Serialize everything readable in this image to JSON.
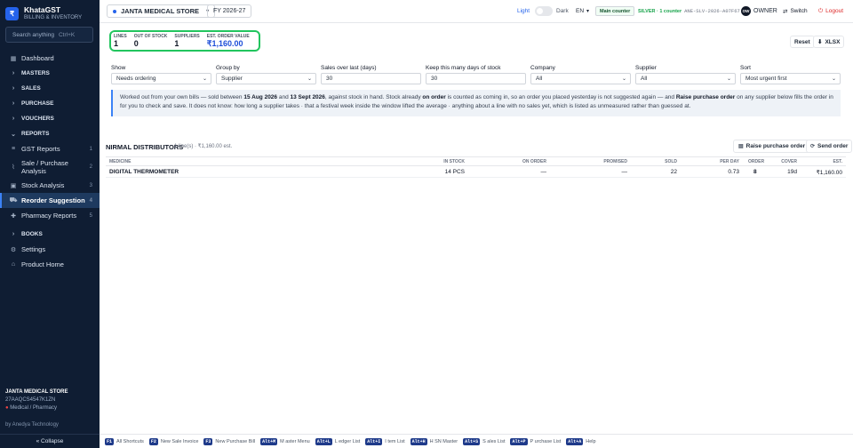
{
  "app": {
    "name": "KhataGST",
    "subtitle": "BILLING & INVENTORY",
    "logo_glyph": "₹"
  },
  "search": {
    "placeholder": "Search anything",
    "shortcut": "Ctrl+K"
  },
  "sidebar": {
    "items": [
      {
        "label": "Dashboard",
        "icon": "grid-icon"
      },
      {
        "label": "MASTERS",
        "icon": "chevron-right-icon"
      },
      {
        "label": "SALES",
        "icon": "chevron-right-icon"
      },
      {
        "label": "PURCHASE",
        "icon": "chevron-right-icon"
      },
      {
        "label": "VOUCHERS",
        "icon": "chevron-right-icon"
      },
      {
        "label": "REPORTS",
        "icon": "chevron-down-icon"
      },
      {
        "label": "GST Reports",
        "icon": "receipt-icon",
        "count": "1"
      },
      {
        "label": "Sale / Purchase Analysis",
        "icon": "chart-icon",
        "count": "2"
      },
      {
        "label": "Stock Analysis",
        "icon": "box-icon",
        "count": "3"
      },
      {
        "label": "Reorder Suggestion",
        "icon": "cart-icon",
        "count": "4"
      },
      {
        "label": "Pharmacy Reports",
        "icon": "pill-icon",
        "count": "5"
      },
      {
        "label": "BOOKS",
        "icon": "chevron-right-icon"
      },
      {
        "label": "Settings",
        "icon": "gear-icon"
      },
      {
        "label": "Product Home",
        "icon": "home-icon"
      }
    ]
  },
  "company": {
    "name": "JANTA MEDICAL STORE",
    "gstin": "27AAQCS4547K1ZN",
    "type": "Medical / Pharmacy"
  },
  "byline": "by Anedya Technology",
  "collapse": "« Collapse",
  "topbar": {
    "store": "JANTA MEDICAL STORE",
    "fy": "FY 2026-27",
    "theme_light": "Light",
    "theme_dark": "Dark",
    "lang": "EN",
    "counter": "Main counter",
    "license": "SILVER · 1 counter",
    "license_key": "ANE-SLV-2026-A07F67",
    "user": "OWNER",
    "user_initials": "OW",
    "switch": "Switch",
    "logout": "Logout"
  },
  "stats": [
    {
      "label": "LINES",
      "value": "1"
    },
    {
      "label": "OUT OF STOCK",
      "value": "0"
    },
    {
      "label": "SUPPLIERS",
      "value": "1"
    },
    {
      "label": "EST. ORDER VALUE",
      "value": "₹1,160.00"
    }
  ],
  "actions": {
    "reset": "Reset",
    "xlsx": "XLSX"
  },
  "filters": [
    {
      "label": "Show",
      "value": "Needs ordering",
      "type": "select"
    },
    {
      "label": "Group by",
      "value": "Supplier",
      "type": "select"
    },
    {
      "label": "Sales over last (days)",
      "value": "30",
      "type": "input"
    },
    {
      "label": "Keep this many days of stock",
      "value": "30",
      "type": "input"
    },
    {
      "label": "Company",
      "value": "All",
      "type": "select"
    },
    {
      "label": "Supplier",
      "value": "All",
      "type": "select"
    },
    {
      "label": "Sort",
      "value": "Most urgent first",
      "type": "select"
    }
  ],
  "info": {
    "p1": "Worked out from your own bills — sold between ",
    "d1": "15 Aug 2026",
    "p2": " and ",
    "d2": "13 Sept 2026",
    "p3": ", against stock in hand. Stock already ",
    "onorder": "on order",
    "p4": " is counted as coming in, so an order you placed yesterday is not suggested again — and ",
    "raise": "Raise purchase order",
    "p5": " on any supplier below fills the order in for you to check and save. It does not know: how long a supplier takes · that a festival week inside the window lifted the average · anything about a line with no sales yet, which is listed as unmeasured rather than guessed at."
  },
  "group": {
    "name": "NIRMAL DISTRIBUTORS",
    "meta": "1 line(s) · ₹1,160.00 est.",
    "raise_button": "Raise purchase order",
    "send_button": "Send order"
  },
  "table": {
    "headers": [
      "MEDICINE",
      "IN STOCK",
      "ON ORDER",
      "PROMISED",
      "SOLD",
      "PER DAY",
      "COVER",
      "ORDER",
      "EST."
    ],
    "rows": [
      [
        "DIGITAL THERMOMETER",
        "14 PCS",
        "—",
        "—",
        "22",
        "0.73",
        "19d",
        "8",
        "₹1,160.00"
      ]
    ]
  },
  "shortcuts": [
    {
      "key": "F1",
      "label": "All Shortcuts"
    },
    {
      "key": "F2",
      "label": "New Sale Invoice"
    },
    {
      "key": "F3",
      "label": "New Purchase Bill"
    },
    {
      "key": "Alt+M",
      "label": "M aster Menu"
    },
    {
      "key": "Alt+L",
      "label": "L edger List"
    },
    {
      "key": "Alt+I",
      "label": "I tem List"
    },
    {
      "key": "Alt+H",
      "label": "H SN Master"
    },
    {
      "key": "Alt+S",
      "label": "S ales List"
    },
    {
      "key": "Alt+P",
      "label": "P urchase List"
    },
    {
      "key": "Alt+A",
      "label": "Help"
    }
  ],
  "colors": {
    "accent": "#2563eb",
    "sidebar": "#0f1d33",
    "highlight": "#22c55e",
    "danger": "#dc2626"
  }
}
